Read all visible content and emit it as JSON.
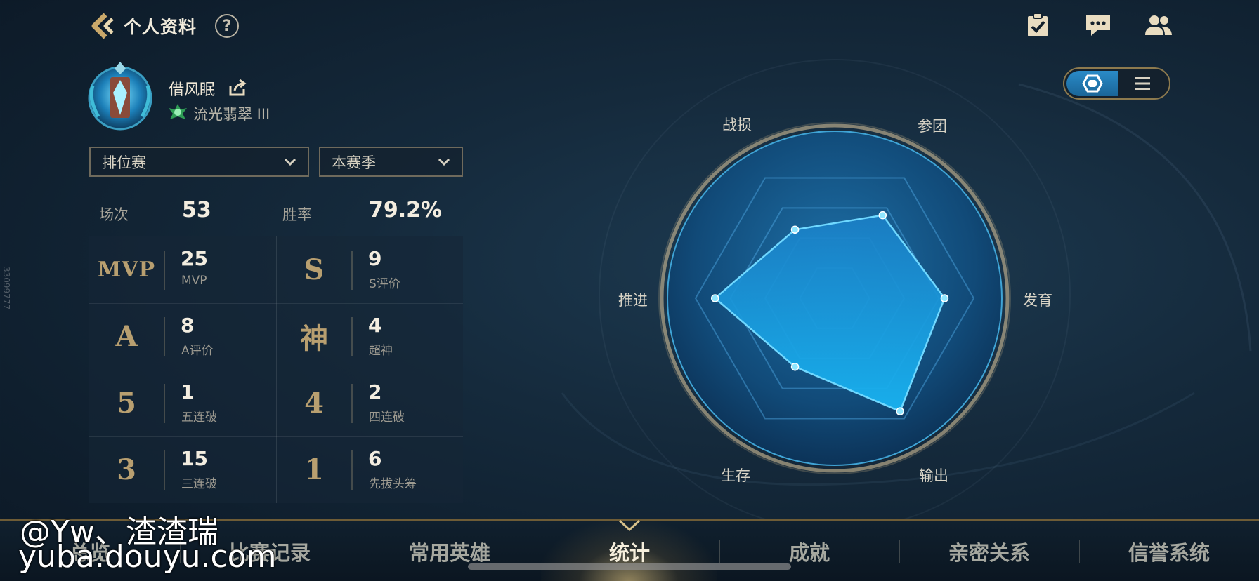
{
  "header": {
    "title": "个人资料",
    "help_symbol": "?"
  },
  "icons": {
    "back": "back-arrow-icon",
    "help": "help-icon",
    "tasks": "clipboard-check-icon",
    "chat": "chat-icon",
    "friends": "friends-icon",
    "share": "share-icon",
    "rank": "rank-emblem-icon",
    "radar_view": "hexagon-icon",
    "list_view": "list-icon"
  },
  "profile": {
    "name": "借风眠",
    "rank": "流光翡翠 III"
  },
  "filters": {
    "mode": "排位赛",
    "season": "本赛季"
  },
  "summary": {
    "games_label": "场次",
    "games_value": "53",
    "winrate_label": "胜率",
    "winrate_value": "79.2%"
  },
  "stats": [
    {
      "glyph": "MVP",
      "value": "25",
      "caption": "MVP"
    },
    {
      "glyph": "S",
      "value": "9",
      "caption": "S评价"
    },
    {
      "glyph": "A",
      "value": "8",
      "caption": "A评价"
    },
    {
      "glyph": "神",
      "value": "4",
      "caption": "超神"
    },
    {
      "glyph": "5",
      "value": "1",
      "caption": "五连破"
    },
    {
      "glyph": "4",
      "value": "2",
      "caption": "四连破"
    },
    {
      "glyph": "3",
      "value": "15",
      "caption": "三连破"
    },
    {
      "glyph": "1",
      "value": "6",
      "caption": "先拔头筹"
    }
  ],
  "radar": {
    "axes": [
      "战损",
      "参团",
      "发育",
      "输出",
      "生存",
      "推进"
    ],
    "values": [
      0.57,
      0.69,
      0.79,
      0.94,
      0.57,
      0.86
    ]
  },
  "colors": {
    "accent_gold": "#b89f70",
    "radar_fill": "#1aa8e8",
    "toggle_active": "#2a8bc8"
  },
  "nav": {
    "tabs": [
      "总览",
      "比赛记录",
      "常用英雄",
      "统计",
      "成就",
      "亲密关系",
      "信誉系统"
    ],
    "active": "统计"
  },
  "watermark": {
    "line1": "@Yw、渣渣瑞",
    "line2": "yuba.douyu.com"
  },
  "side_id": "33099777"
}
